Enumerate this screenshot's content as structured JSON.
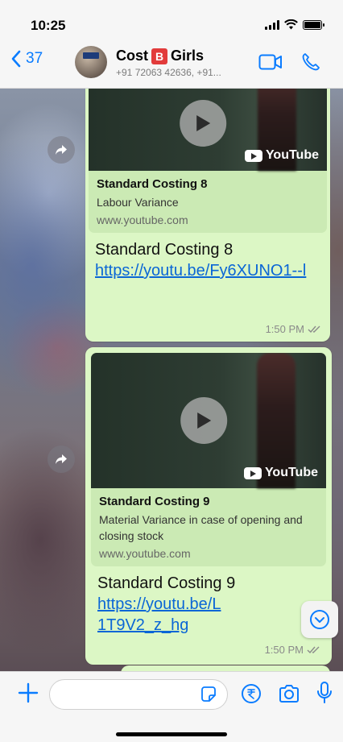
{
  "status_bar": {
    "time": "10:25"
  },
  "header": {
    "back_count": "37",
    "title_main": "Cost",
    "title_badge": "B",
    "title_rest": "Girls",
    "subtitle": "+91 72063 42636, +91..."
  },
  "messages": [
    {
      "preview_title": "Standard Costing 8",
      "preview_desc": "Labour Variance",
      "preview_domain": "www.youtube.com",
      "thumb_brand": "YouTube",
      "text": "Standard Costing 8",
      "link": "https://youtu.be/Fy6XUNO1--l",
      "time": "1:50 PM"
    },
    {
      "preview_title": "Standard Costing 9",
      "preview_desc": "Material Variance in case of opening and closing stock",
      "preview_domain": "www.youtube.com",
      "thumb_brand": "YouTube",
      "text": "Standard Costing 9",
      "link": "https://youtu.be/L1T9V2_z_hg",
      "time": "1:50 PM"
    }
  ],
  "colors": {
    "accent": "#0a7cff",
    "bubble": "#dcf7c5",
    "link": "#0a66d6"
  }
}
